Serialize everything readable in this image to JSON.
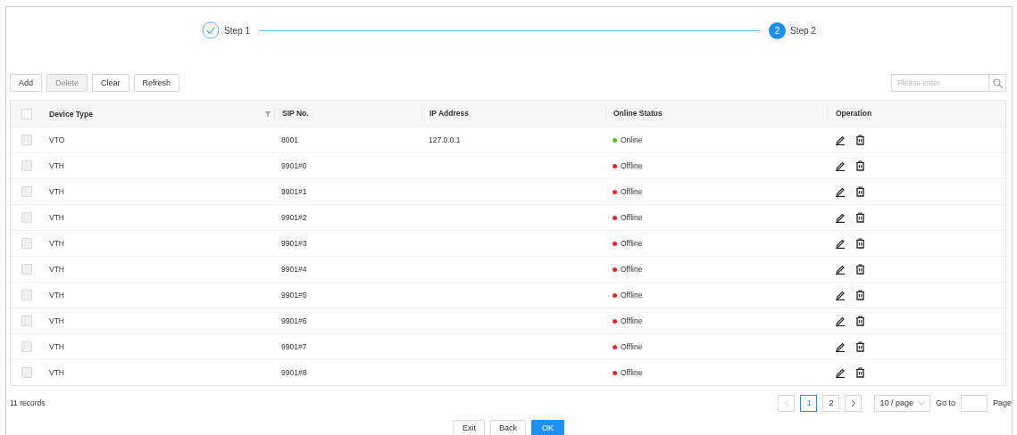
{
  "steps": [
    {
      "label": "Step 1",
      "done": true
    },
    {
      "label": "Step 2",
      "number": "2",
      "done": false
    }
  ],
  "toolbar": {
    "buttons": [
      {
        "label": "Add",
        "disabled": false
      },
      {
        "label": "Delete",
        "disabled": true
      },
      {
        "label": "Clear",
        "disabled": false
      },
      {
        "label": "Refresh",
        "disabled": false
      }
    ],
    "search": {
      "placeholder": "Please enter"
    }
  },
  "table": {
    "header_checked": false,
    "columns": [
      {
        "label": "Device Type",
        "filter": true
      },
      {
        "label": "SIP No.",
        "filter": false
      },
      {
        "label": "IP Address",
        "filter": false
      },
      {
        "label": "Online Status",
        "filter": false
      },
      {
        "label": "Operation",
        "filter": false
      }
    ],
    "rows": [
      {
        "device_type": "VTO",
        "sip_no": "8001",
        "ip_address": "127.0.0.1",
        "status": "Online",
        "online": true,
        "checked": false,
        "disabled": true
      },
      {
        "device_type": "VTH",
        "sip_no": "9901#0",
        "ip_address": "",
        "status": "Offline",
        "online": false,
        "checked": false,
        "disabled": true
      },
      {
        "device_type": "VTH",
        "sip_no": "9901#1",
        "ip_address": "",
        "status": "Offline",
        "online": false,
        "checked": false,
        "disabled": true
      },
      {
        "device_type": "VTH",
        "sip_no": "9901#2",
        "ip_address": "",
        "status": "Offline",
        "online": false,
        "checked": false,
        "disabled": true
      },
      {
        "device_type": "VTH",
        "sip_no": "9901#3",
        "ip_address": "",
        "status": "Offline",
        "online": false,
        "checked": false,
        "disabled": true
      },
      {
        "device_type": "VTH",
        "sip_no": "9901#4",
        "ip_address": "",
        "status": "Offline",
        "online": false,
        "checked": false,
        "disabled": true
      },
      {
        "device_type": "VTH",
        "sip_no": "9901#5",
        "ip_address": "",
        "status": "Offline",
        "online": false,
        "checked": false,
        "disabled": true
      },
      {
        "device_type": "VTH",
        "sip_no": "9901#6",
        "ip_address": "",
        "status": "Offline",
        "online": false,
        "checked": false,
        "disabled": true
      },
      {
        "device_type": "VTH",
        "sip_no": "9901#7",
        "ip_address": "",
        "status": "Offline",
        "online": false,
        "checked": false,
        "disabled": true
      },
      {
        "device_type": "VTH",
        "sip_no": "9901#8",
        "ip_address": "",
        "status": "Offline",
        "online": false,
        "checked": false,
        "disabled": true
      }
    ]
  },
  "footer": {
    "records": "11 records",
    "pages": [
      {
        "label": "1",
        "selected": true
      },
      {
        "label": "2",
        "selected": false
      }
    ],
    "prev_disabled": true,
    "next_disabled": false,
    "page_size": "10 / page",
    "goto_label": "Go to",
    "page_label": "Page"
  },
  "actions": [
    {
      "label": "Exit",
      "primary": false
    },
    {
      "label": "Back",
      "primary": false
    },
    {
      "label": "OK",
      "primary": true
    }
  ]
}
